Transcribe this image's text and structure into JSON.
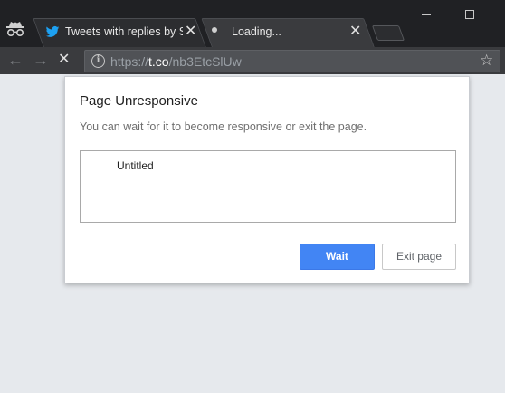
{
  "browser": {
    "tabs": [
      {
        "title": "Tweets with replies by S",
        "favicon": "twitter-bird-icon",
        "active": false
      },
      {
        "title": "Loading...",
        "favicon": "loading-spinner-icon",
        "active": true
      }
    ],
    "close_glyph": "✕",
    "url_scheme": "https://",
    "url_host": "t.co",
    "url_path": "/nb3EtcSlUw",
    "colors": {
      "titlebar": "#202124",
      "toolbar": "#3a3b3e",
      "twitter": "#1da1f2"
    }
  },
  "dialog": {
    "title": "Page Unresponsive",
    "message": "You can wait for it to become responsive or exit the page.",
    "pages": [
      "Untitled"
    ],
    "wait_label": "Wait",
    "exit_label": "Exit page",
    "accent": "#4285f4"
  }
}
